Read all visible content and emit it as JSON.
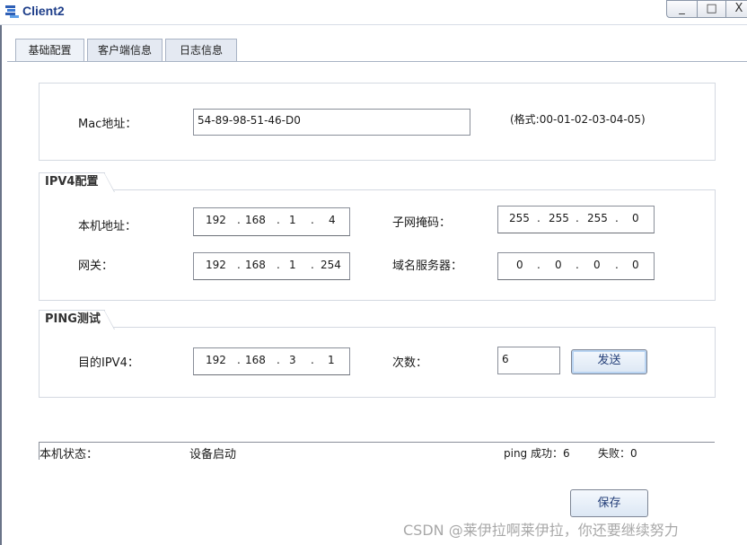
{
  "window": {
    "title": "Client2",
    "minimize_label": "_",
    "maximize_label": "□",
    "close_label": "X"
  },
  "tabs": [
    {
      "label": "基础配置"
    },
    {
      "label": "客户端信息"
    },
    {
      "label": "日志信息"
    }
  ],
  "mac": {
    "label": "Mac地址：",
    "value": "54-89-98-51-46-D0",
    "format_hint": "(格式:00-01-02-03-04-05)"
  },
  "ipv4": {
    "section_title": "IPV4配置",
    "local_addr_label": "本机地址：",
    "local_addr": [
      "192",
      "168",
      "1",
      "4"
    ],
    "subnet_mask_label": "子网掩码：",
    "subnet_mask": [
      "255",
      "255",
      "255",
      "0"
    ],
    "gateway_label": "网关：",
    "gateway": [
      "192",
      "168",
      "1",
      "254"
    ],
    "dns_label": "域名服务器：",
    "dns": [
      "0",
      "0",
      "0",
      "0"
    ]
  },
  "ping": {
    "section_title": "PING测试",
    "target_label": "目的IPV4：",
    "target": [
      "192",
      "168",
      "3",
      "1"
    ],
    "count_label": "次数：",
    "count_value": "6",
    "send_label": "发送"
  },
  "status": {
    "label": "本机状态：",
    "value": "设备启动",
    "success_text": "ping 成功：6",
    "fail_text": "失败：0"
  },
  "save_label": "保存",
  "watermark": "CSDN @莱伊拉啊莱伊拉，你还要继续努力"
}
